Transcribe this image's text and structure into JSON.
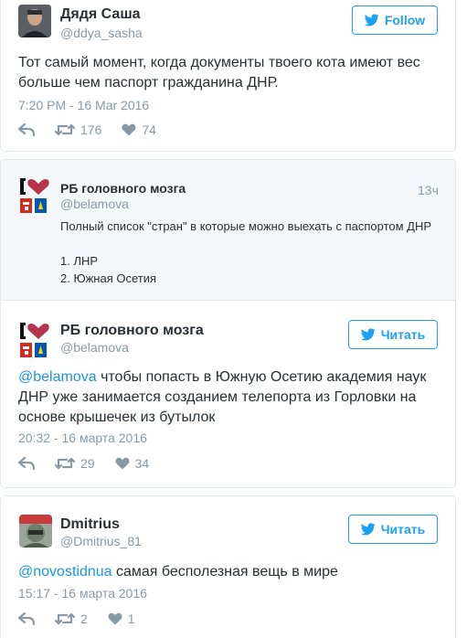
{
  "tweet1": {
    "name": "Дядя Саша",
    "handle": "@ddya_sasha",
    "follow_label": "Follow",
    "text": "Тот самый момент, когда документы твоего кота имеют вес больше чем паспорт гражданина ДНР.",
    "timestamp": "7:20 PM - 16 Mar 2016",
    "retweets": "176",
    "likes": "74"
  },
  "quoted": {
    "name": "РБ головного мозга",
    "handle": "@belamova",
    "time_ago": "13ч",
    "line1": "Полный список \"стран\" в которые можно выехать с паспортом ДНР",
    "item1": "1. ЛНР",
    "item2": "2. Южная Осетия"
  },
  "tweet2": {
    "name": "РБ головного мозга",
    "handle": "@belamova",
    "follow_label": "Читать",
    "mention": "@belamova",
    "text": " чтобы попасть в Южную Осетию академия наук ДНР уже занимается созданием телепорта из Горловки на основе крышечек из бутылок",
    "timestamp": "20:32 - 16 марта 2016",
    "retweets": "29",
    "likes": "34"
  },
  "tweet3": {
    "name": "Dmitrius",
    "handle": "@Dmitrius_81",
    "follow_label": "Читать",
    "mention": "@novostidnua",
    "text": " самая бесполезная вещь в мире",
    "timestamp": "15:17 - 16 марта 2016",
    "retweets": "2",
    "likes": "1"
  },
  "colors": {
    "accent": "#1da1f2",
    "link": "#1b95e0",
    "muted": "#8899a6",
    "heart": "#e0245e",
    "ukraine_blue": "#0057b7",
    "ukraine_yellow": "#ffd700"
  }
}
